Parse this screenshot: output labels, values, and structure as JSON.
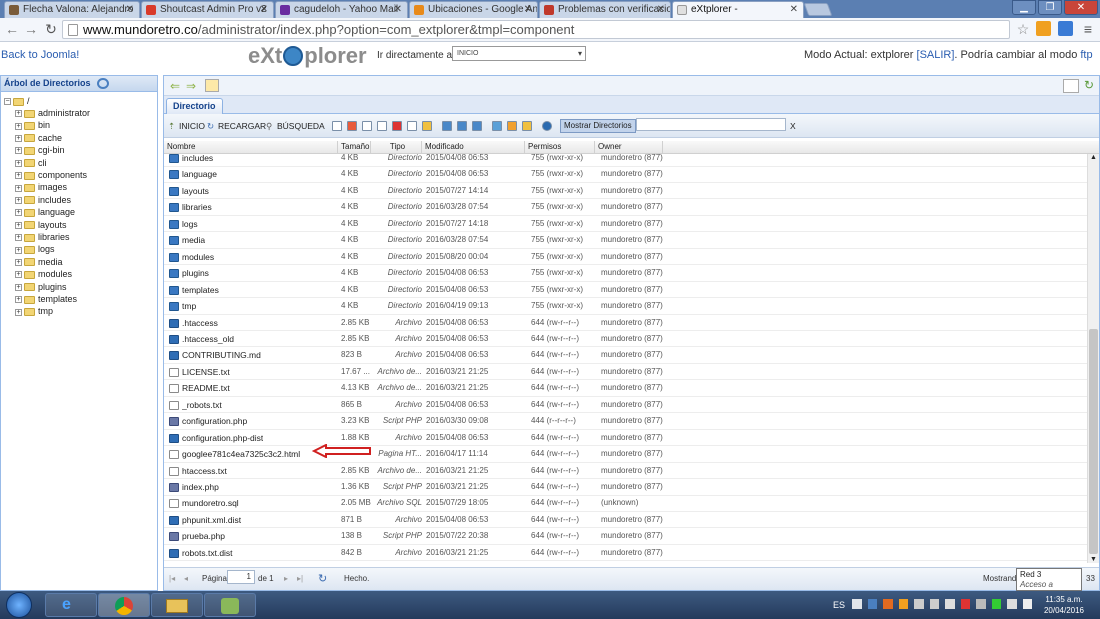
{
  "browser": {
    "tabs": [
      {
        "title": "Flecha Valona: Alejandro",
        "icon_color": "#7a5c3a",
        "active": false
      },
      {
        "title": "Shoutcast Admin Pro v2",
        "icon_color": "#d93a2a",
        "active": false
      },
      {
        "title": "cagudeloh - Yahoo Mail",
        "icon_color": "#6a2ca0",
        "active": false
      },
      {
        "title": "Ubicaciones - Google An",
        "icon_color": "#e88a1a",
        "active": false
      },
      {
        "title": "Problemas con verificacio",
        "icon_color": "#c0392b",
        "active": false
      },
      {
        "title": "eXtplorer -",
        "icon_color": "#e0e0e0",
        "active": true
      }
    ],
    "url_host": "www.mundoretro.co",
    "url_path": "/administrator/index.php?option=com_extplorer&tmpl=component"
  },
  "header": {
    "back_link": "Back to Joomla!",
    "logo_left": "eXt",
    "logo_right": "plorer",
    "goto_label": "Ir directamente a:",
    "goto_value": "INICIO",
    "mode_prefix": "Modo Actual: extplorer",
    "salir": "[SALIR]",
    "mode_middle": ". Podría cambiar al modo",
    "ftp": "ftp"
  },
  "tree": {
    "title": "Árbol de Directorios",
    "root": "/",
    "items": [
      "administrator",
      "bin",
      "cache",
      "cgi-bin",
      "cli",
      "components",
      "images",
      "includes",
      "language",
      "layouts",
      "libraries",
      "logs",
      "media",
      "modules",
      "plugins",
      "templates",
      "tmp"
    ]
  },
  "panel": {
    "tab": "Directorio",
    "toolbar": {
      "home": "INICIO",
      "reload": "RECARGAR",
      "search": "BÚSQUEDA",
      "show_dirs": "Mostrar Directorios",
      "clear": "X"
    },
    "columns": [
      "Nombre",
      "Tamaño",
      "Tipo",
      "Modificado",
      "Permisos",
      "Owner"
    ],
    "rows": [
      {
        "name": "includes",
        "size": "4 KB",
        "type": "Directorio",
        "modified": "2015/04/08 06:53",
        "perms": "755 (rwxr-xr-x)",
        "owner": "mundoretro (877)",
        "icon": "folder"
      },
      {
        "name": "language",
        "size": "4 KB",
        "type": "Directorio",
        "modified": "2015/04/08 06:53",
        "perms": "755 (rwxr-xr-x)",
        "owner": "mundoretro (877)",
        "icon": "folder"
      },
      {
        "name": "layouts",
        "size": "4 KB",
        "type": "Directorio",
        "modified": "2015/07/27 14:14",
        "perms": "755 (rwxr-xr-x)",
        "owner": "mundoretro (877)",
        "icon": "folder"
      },
      {
        "name": "libraries",
        "size": "4 KB",
        "type": "Directorio",
        "modified": "2016/03/28 07:54",
        "perms": "755 (rwxr-xr-x)",
        "owner": "mundoretro (877)",
        "icon": "folder"
      },
      {
        "name": "logs",
        "size": "4 KB",
        "type": "Directorio",
        "modified": "2015/07/27 14:18",
        "perms": "755 (rwxr-xr-x)",
        "owner": "mundoretro (877)",
        "icon": "folder"
      },
      {
        "name": "media",
        "size": "4 KB",
        "type": "Directorio",
        "modified": "2016/03/28 07:54",
        "perms": "755 (rwxr-xr-x)",
        "owner": "mundoretro (877)",
        "icon": "folder"
      },
      {
        "name": "modules",
        "size": "4 KB",
        "type": "Directorio",
        "modified": "2015/08/20 00:04",
        "perms": "755 (rwxr-xr-x)",
        "owner": "mundoretro (877)",
        "icon": "folder"
      },
      {
        "name": "plugins",
        "size": "4 KB",
        "type": "Directorio",
        "modified": "2015/04/08 06:53",
        "perms": "755 (rwxr-xr-x)",
        "owner": "mundoretro (877)",
        "icon": "folder"
      },
      {
        "name": "templates",
        "size": "4 KB",
        "type": "Directorio",
        "modified": "2015/04/08 06:53",
        "perms": "755 (rwxr-xr-x)",
        "owner": "mundoretro (877)",
        "icon": "folder"
      },
      {
        "name": "tmp",
        "size": "4 KB",
        "type": "Directorio",
        "modified": "2016/04/19 09:13",
        "perms": "755 (rwxr-xr-x)",
        "owner": "mundoretro (877)",
        "icon": "folder"
      },
      {
        "name": ".htaccess",
        "size": "2.85 KB",
        "type": "Archivo",
        "modified": "2015/04/08 06:53",
        "perms": "644 (rw-r--r--)",
        "owner": "mundoretro (877)",
        "icon": "doc"
      },
      {
        "name": ".htaccess_old",
        "size": "2.85 KB",
        "type": "Archivo",
        "modified": "2015/04/08 06:53",
        "perms": "644 (rw-r--r--)",
        "owner": "mundoretro (877)",
        "icon": "doc"
      },
      {
        "name": "CONTRIBUTING.md",
        "size": "823 B",
        "type": "Archivo",
        "modified": "2015/04/08 06:53",
        "perms": "644 (rw-r--r--)",
        "owner": "mundoretro (877)",
        "icon": "doc"
      },
      {
        "name": "LICENSE.txt",
        "size": "17.67 ...",
        "type": "Archivo de...",
        "modified": "2016/03/21 21:25",
        "perms": "644 (rw-r--r--)",
        "owner": "mundoretro (877)",
        "icon": "file"
      },
      {
        "name": "README.txt",
        "size": "4.13 KB",
        "type": "Archivo de...",
        "modified": "2016/03/21 21:25",
        "perms": "644 (rw-r--r--)",
        "owner": "mundoretro (877)",
        "icon": "file"
      },
      {
        "name": "_robots.txt",
        "size": "865 B",
        "type": "Archivo",
        "modified": "2015/04/08 06:53",
        "perms": "644 (rw-r--r--)",
        "owner": "mundoretro (877)",
        "icon": "file"
      },
      {
        "name": "configuration.php",
        "size": "3.23 KB",
        "type": "Script PHP",
        "modified": "2016/03/30 09:08",
        "perms": "444 (r--r--r--)",
        "owner": "mundoretro (877)",
        "icon": "php"
      },
      {
        "name": "configuration.php-dist",
        "size": "1.88 KB",
        "type": "Archivo",
        "modified": "2015/04/08 06:53",
        "perms": "644 (rw-r--r--)",
        "owner": "mundoretro (877)",
        "icon": "doc"
      },
      {
        "name": "googlee781c4ea7325c3c2.html",
        "size": "",
        "type": "Pagina HT...",
        "modified": "2016/04/17 11:14",
        "perms": "644 (rw-r--r--)",
        "owner": "mundoretro (877)",
        "icon": "file"
      },
      {
        "name": "htaccess.txt",
        "size": "2.85 KB",
        "type": "Archivo de...",
        "modified": "2016/03/21 21:25",
        "perms": "644 (rw-r--r--)",
        "owner": "mundoretro (877)",
        "icon": "file"
      },
      {
        "name": "index.php",
        "size": "1.36 KB",
        "type": "Script PHP",
        "modified": "2016/03/21 21:25",
        "perms": "644 (rw-r--r--)",
        "owner": "mundoretro (877)",
        "icon": "php"
      },
      {
        "name": "mundoretro.sql",
        "size": "2.05 MB",
        "type": "Archivo SQL",
        "modified": "2015/07/29 18:05",
        "perms": "644 (rw-r--r--)",
        "owner": "(unknown)",
        "icon": "file"
      },
      {
        "name": "phpunit.xml.dist",
        "size": "871 B",
        "type": "Archivo",
        "modified": "2015/04/08 06:53",
        "perms": "644 (rw-r--r--)",
        "owner": "mundoretro (877)",
        "icon": "doc"
      },
      {
        "name": "prueba.php",
        "size": "138 B",
        "type": "Script PHP",
        "modified": "2015/07/22 20:38",
        "perms": "644 (rw-r--r--)",
        "owner": "mundoretro (877)",
        "icon": "php"
      },
      {
        "name": "robots.txt.dist",
        "size": "842 B",
        "type": "Archivo",
        "modified": "2016/03/21 21:25",
        "perms": "644 (rw-r--r--)",
        "owner": "mundoretro (877)",
        "icon": "doc"
      }
    ],
    "pager": {
      "label": "Página",
      "page": "1",
      "of": "de 1",
      "status": "Hecho.",
      "showing": "Mostrando",
      "showing_count": "33"
    }
  },
  "tooltip": {
    "line1": "Red 3",
    "line2": "Acceso a Internet"
  },
  "taskbar": {
    "lang": "ES",
    "time": "11:35 a.m.",
    "date": "20/04/2016"
  }
}
